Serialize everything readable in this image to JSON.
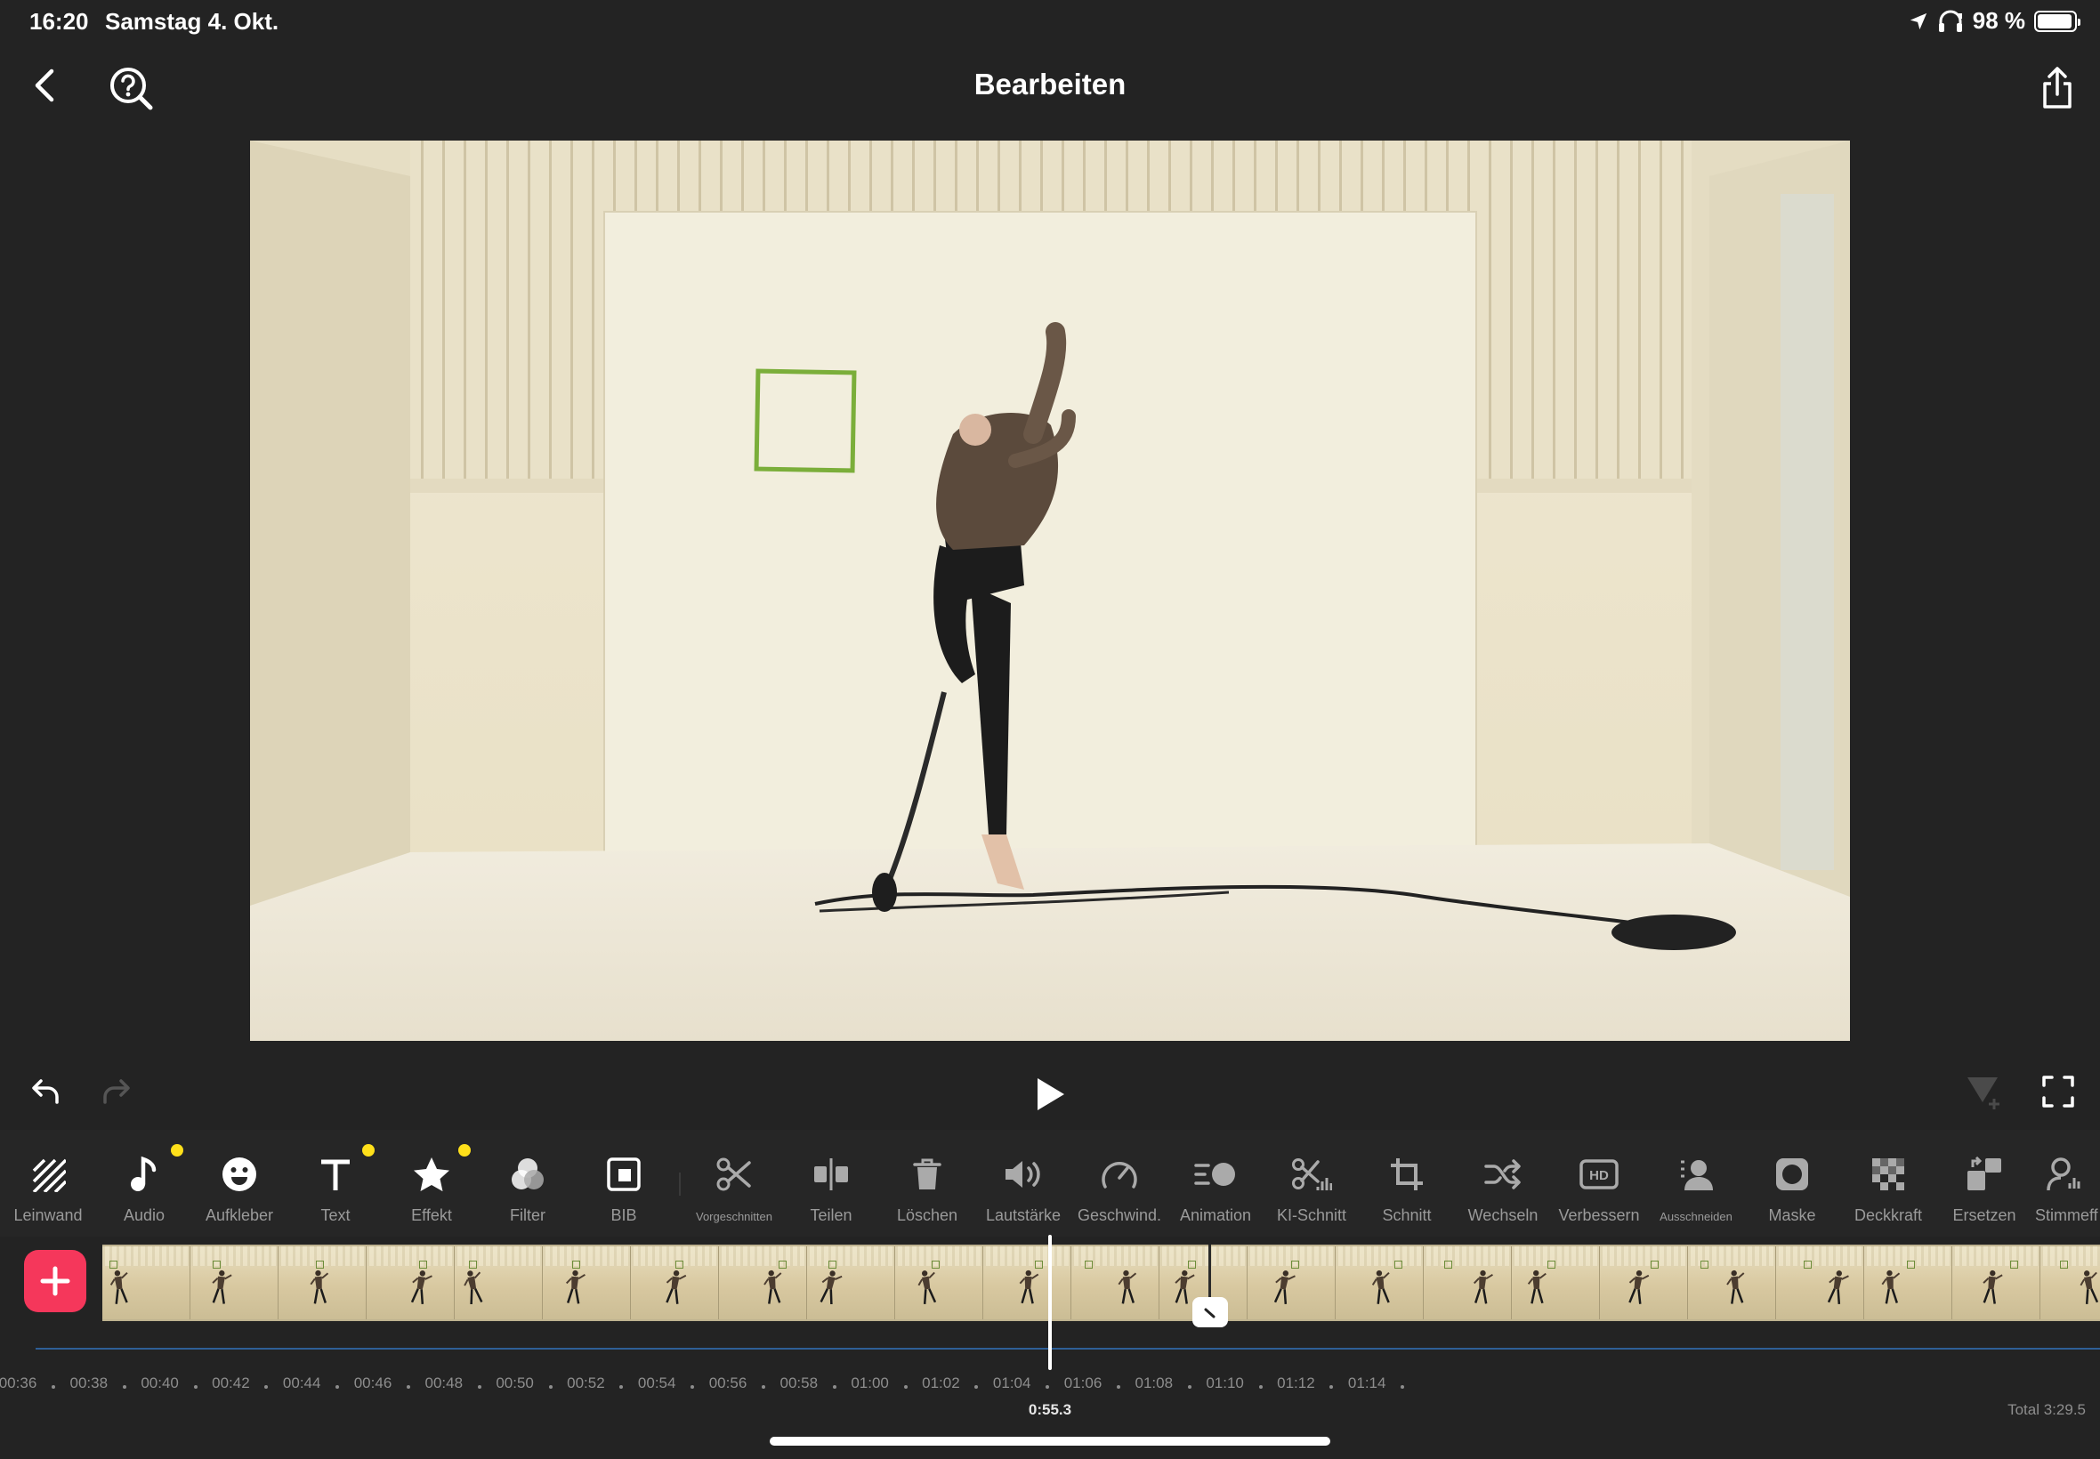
{
  "status": {
    "time": "16:20",
    "date": "Samstag 4. Okt.",
    "battery": "98 %"
  },
  "header": {
    "title": "Bearbeiten"
  },
  "toolbar": {
    "items": [
      {
        "label": "Leinwand"
      },
      {
        "label": "Audio"
      },
      {
        "label": "Aufkleber"
      },
      {
        "label": "Text"
      },
      {
        "label": "Effekt"
      },
      {
        "label": "Filter"
      },
      {
        "label": "BIB"
      },
      {
        "label": "Vorgeschnitten"
      },
      {
        "label": "Teilen"
      },
      {
        "label": "Löschen"
      },
      {
        "label": "Lautstärke"
      },
      {
        "label": "Geschwind."
      },
      {
        "label": "Animation"
      },
      {
        "label": "KI-Schnitt"
      },
      {
        "label": "Schnitt"
      },
      {
        "label": "Wechseln"
      },
      {
        "label": "Verbessern"
      },
      {
        "label": "Ausschneiden"
      },
      {
        "label": "Maske"
      },
      {
        "label": "Deckkraft"
      },
      {
        "label": "Ersetzen"
      },
      {
        "label": "Stimmeff"
      }
    ]
  },
  "timeline": {
    "ticks": [
      "00:36",
      "00:38",
      "00:40",
      "00:42",
      "00:44",
      "00:46",
      "00:48",
      "00:50",
      "00:52",
      "00:54",
      "00:56",
      "00:58",
      "01:00",
      "01:02",
      "01:04",
      "01:06",
      "01:08",
      "01:10",
      "01:12",
      "01:14"
    ],
    "current_time": "0:55.3",
    "total": "Total 3:29.5"
  },
  "colors": {
    "accent": "#f5375b",
    "badge": "#ffe01a",
    "audio_line": "#2e5f96",
    "background": "#232323"
  }
}
